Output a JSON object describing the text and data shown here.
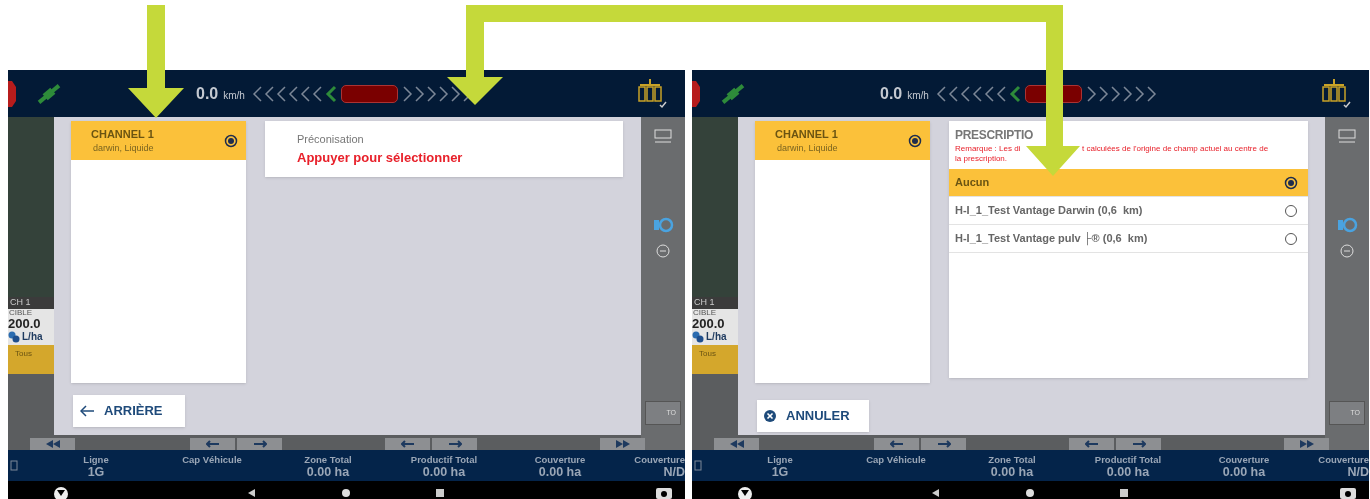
{
  "screens": [
    {
      "top_bar": {
        "speed": "0.0",
        "speed_unit": "km/h"
      },
      "background": {
        "channel_tag": "CH 1",
        "target_label": "CIBLE",
        "target_value": "200.0",
        "target_unit": "L/ha",
        "section_button": "Tous",
        "auto_button": "TO"
      },
      "dialog": {
        "kind": "product",
        "channels": [
          {
            "name": "CHANNEL 1",
            "product": "darwin, Liquide",
            "selected": true
          }
        ],
        "prescription_field": {
          "label": "Préconisation",
          "value": "Appuyer pour sélectionner"
        },
        "footer_button": {
          "kind": "back",
          "label": "ARRIÈRE"
        }
      },
      "stats": [
        {
          "label": "Ligne",
          "value": "1G"
        },
        {
          "label": "Cap Véhicule"
        },
        {
          "label": "Zone Total",
          "value": "0.00 ha"
        },
        {
          "label": "Productif Total",
          "value": "0.00 ha"
        },
        {
          "label": "Couverture",
          "value": "0.00 ha"
        },
        {
          "label": "Couverture",
          "value": "N/D"
        }
      ]
    },
    {
      "top_bar": {
        "speed": "0.0",
        "speed_unit": "km/h"
      },
      "background": {
        "channel_tag": "CH 1",
        "target_label": "CIBLE",
        "target_value": "200.0",
        "target_unit": "L/ha",
        "section_button": "Tous",
        "auto_button": "TO"
      },
      "dialog": {
        "kind": "prescription",
        "channels": [
          {
            "name": "CHANNEL 1",
            "product": "darwin, Liquide",
            "selected": true
          }
        ],
        "title": "PRESCRIPTIO",
        "remark": [
          "Remarque : Les di",
          "t calculées de l'origine de champ actuel au centre de",
          "la prescription."
        ],
        "options": [
          {
            "label": "Aucun",
            "selected": true
          },
          {
            "label": "H-I_1_Test Vantage Darwin (0,6  km)",
            "selected": false
          },
          {
            "label": "H-I_1_Test Vantage pulv ├® (0,6  km)",
            "selected": false
          }
        ],
        "footer_button": {
          "kind": "cancel",
          "label": "ANNULER"
        }
      },
      "stats": [
        {
          "label": "Ligne",
          "value": "1G"
        },
        {
          "label": "Cap Véhicule"
        },
        {
          "label": "Zone Total",
          "value": "0.00 ha"
        },
        {
          "label": "Productif Total",
          "value": "0.00 ha"
        },
        {
          "label": "Couverture",
          "value": "0.00 ha"
        },
        {
          "label": "Couverture",
          "value": "N/D"
        }
      ]
    }
  ]
}
